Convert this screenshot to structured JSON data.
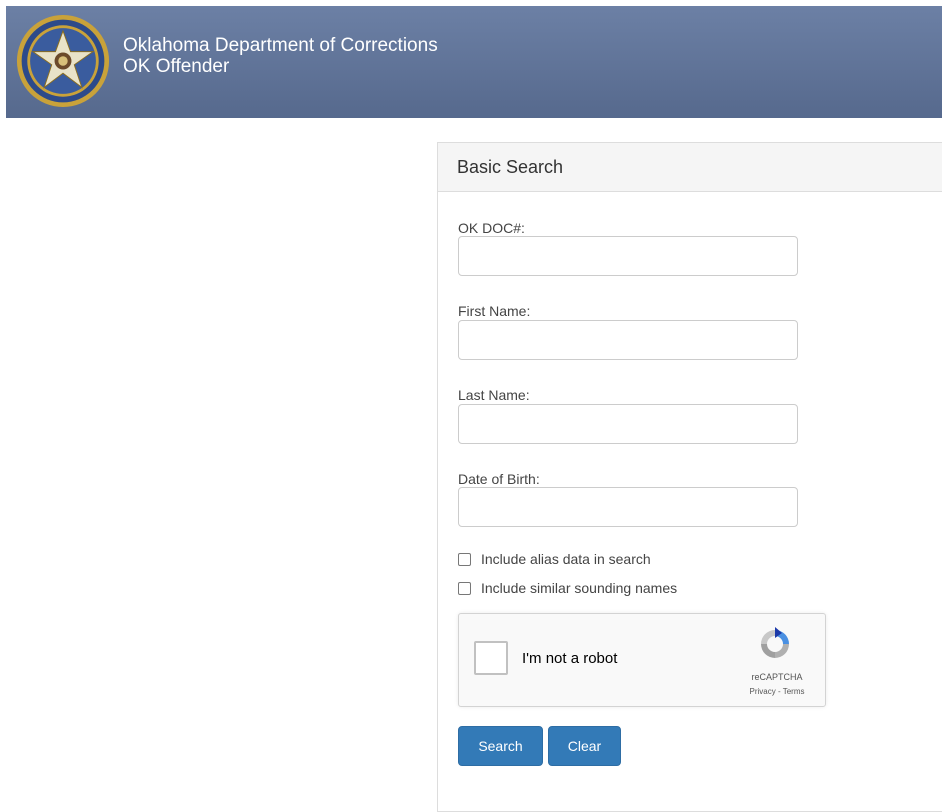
{
  "header": {
    "agency": "Oklahoma Department of Corrections",
    "app": "OK Offender",
    "seal_icon": "oklahoma-state-seal-icon"
  },
  "search": {
    "heading": "Basic Search",
    "fields": [
      {
        "label": "OK DOC#:",
        "value": "",
        "placeholder": ""
      },
      {
        "label": "First Name:",
        "value": "",
        "placeholder": ""
      },
      {
        "label": "Last Name:",
        "value": "",
        "placeholder": ""
      },
      {
        "label": "Date of Birth:",
        "value": "",
        "placeholder": ""
      }
    ],
    "options": [
      {
        "label": "Include alias data in search",
        "checked": false
      },
      {
        "label": "Include similar sounding names",
        "checked": false
      }
    ],
    "captcha": {
      "label": "I'm not a robot",
      "brand": "reCAPTCHA",
      "links": "Privacy - Terms",
      "icon": "recaptcha-logo-icon"
    },
    "buttons": {
      "search": "Search",
      "clear": "Clear"
    }
  },
  "colors": {
    "header_bg": "#5f7397",
    "primary_button": "#337ab7"
  }
}
